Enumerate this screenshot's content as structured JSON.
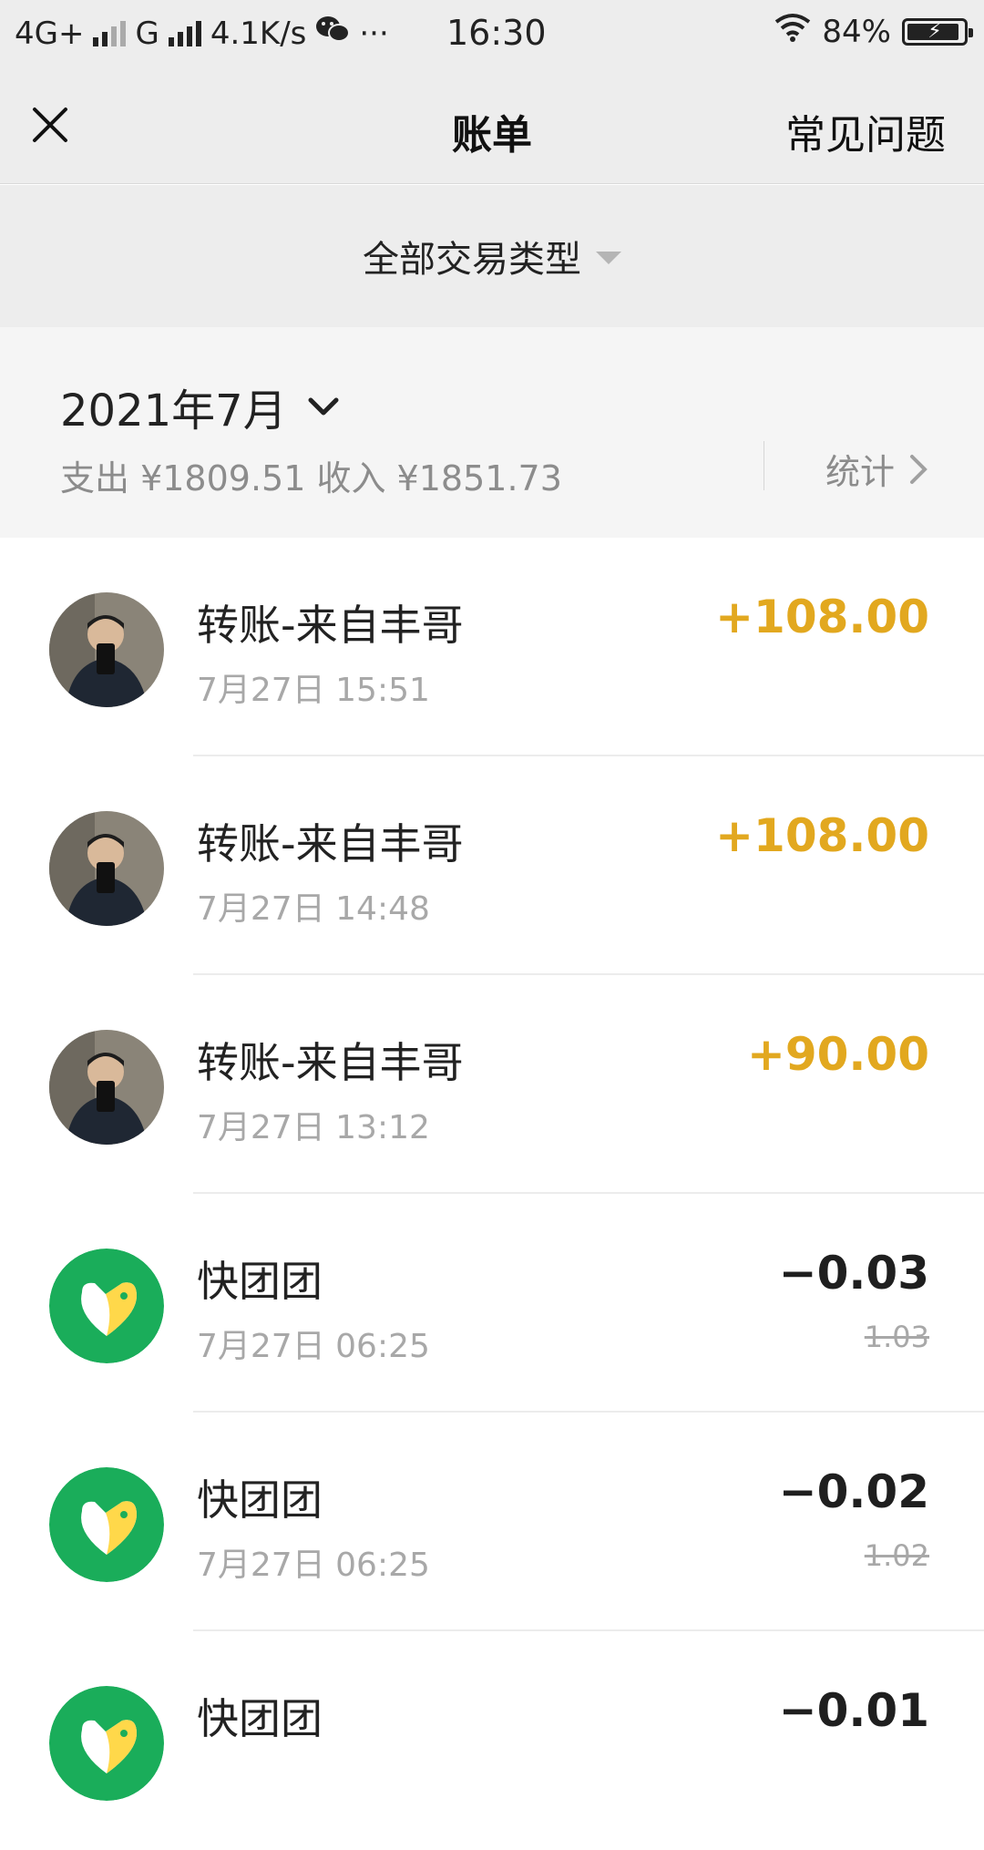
{
  "status_bar": {
    "network1": "4G+",
    "network2": "G",
    "speed": "4.1K/s",
    "more": "···",
    "time": "16:30",
    "battery": "84%"
  },
  "nav": {
    "title": "账单",
    "faq_label": "常见问题"
  },
  "filter": {
    "label": "全部交易类型"
  },
  "summary": {
    "month": "2021年7月",
    "totals": "支出 ¥1809.51 收入 ¥1851.73",
    "stats_label": "统计"
  },
  "colors": {
    "income": "#e2a81f",
    "expense": "#1f1f1f",
    "brand_green": "#1aad5a",
    "header_bg": "#ededed"
  },
  "transactions": [
    {
      "name": "转账-来自丰哥",
      "time": "7月27日 15:51",
      "amount": "+108.00",
      "type": "income",
      "icon": "person-avatar"
    },
    {
      "name": "转账-来自丰哥",
      "time": "7月27日 14:48",
      "amount": "+108.00",
      "type": "income",
      "icon": "person-avatar"
    },
    {
      "name": "转账-来自丰哥",
      "time": "7月27日 13:12",
      "amount": "+90.00",
      "type": "income",
      "icon": "person-avatar"
    },
    {
      "name": "快团团",
      "time": "7月27日 06:25",
      "amount": "−0.03",
      "original": "1.03",
      "type": "expense",
      "icon": "kuaituantuan-logo"
    },
    {
      "name": "快团团",
      "time": "7月27日 06:25",
      "amount": "−0.02",
      "original": "1.02",
      "type": "expense",
      "icon": "kuaituantuan-logo"
    },
    {
      "name": "快团团",
      "time": "",
      "amount": "−0.01",
      "type": "expense",
      "icon": "kuaituantuan-logo"
    }
  ]
}
